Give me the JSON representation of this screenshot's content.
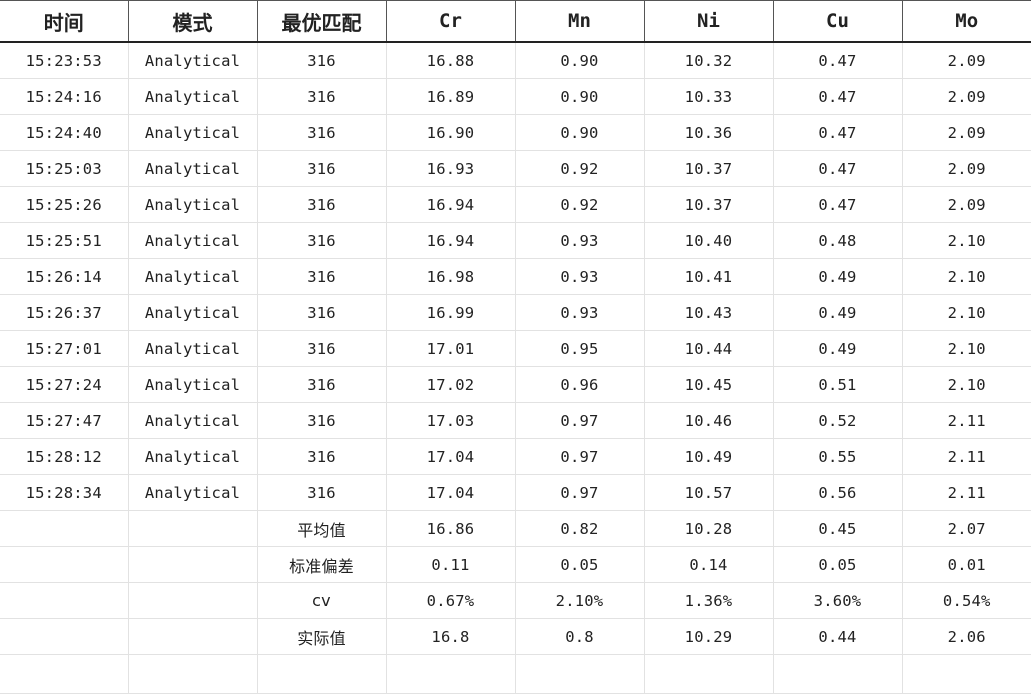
{
  "table": {
    "headers": [
      "时间",
      "模式",
      "最优匹配",
      "Cr",
      "Mn",
      "Ni",
      "Cu",
      "Mo"
    ],
    "rows": [
      [
        "15:23:53",
        "Analytical",
        "316",
        "16.88",
        "0.90",
        "10.32",
        "0.47",
        "2.09"
      ],
      [
        "15:24:16",
        "Analytical",
        "316",
        "16.89",
        "0.90",
        "10.33",
        "0.47",
        "2.09"
      ],
      [
        "15:24:40",
        "Analytical",
        "316",
        "16.90",
        "0.90",
        "10.36",
        "0.47",
        "2.09"
      ],
      [
        "15:25:03",
        "Analytical",
        "316",
        "16.93",
        "0.92",
        "10.37",
        "0.47",
        "2.09"
      ],
      [
        "15:25:26",
        "Analytical",
        "316",
        "16.94",
        "0.92",
        "10.37",
        "0.47",
        "2.09"
      ],
      [
        "15:25:51",
        "Analytical",
        "316",
        "16.94",
        "0.93",
        "10.40",
        "0.48",
        "2.10"
      ],
      [
        "15:26:14",
        "Analytical",
        "316",
        "16.98",
        "0.93",
        "10.41",
        "0.49",
        "2.10"
      ],
      [
        "15:26:37",
        "Analytical",
        "316",
        "16.99",
        "0.93",
        "10.43",
        "0.49",
        "2.10"
      ],
      [
        "15:27:01",
        "Analytical",
        "316",
        "17.01",
        "0.95",
        "10.44",
        "0.49",
        "2.10"
      ],
      [
        "15:27:24",
        "Analytical",
        "316",
        "17.02",
        "0.96",
        "10.45",
        "0.51",
        "2.10"
      ],
      [
        "15:27:47",
        "Analytical",
        "316",
        "17.03",
        "0.97",
        "10.46",
        "0.52",
        "2.11"
      ],
      [
        "15:28:12",
        "Analytical",
        "316",
        "17.04",
        "0.97",
        "10.49",
        "0.55",
        "2.11"
      ],
      [
        "15:28:34",
        "Analytical",
        "316",
        "17.04",
        "0.97",
        "10.57",
        "0.56",
        "2.11"
      ]
    ],
    "summary": [
      {
        "label": "平均值",
        "values": [
          "16.86",
          "0.82",
          "10.28",
          "0.45",
          "2.07"
        ]
      },
      {
        "label": "标准偏差",
        "values": [
          "0.11",
          "0.05",
          "0.14",
          "0.05",
          "0.01"
        ]
      },
      {
        "label": "cv",
        "values": [
          "0.67%",
          "2.10%",
          "1.36%",
          "3.60%",
          "0.54%"
        ]
      },
      {
        "label": "实际值",
        "values": [
          "16.8",
          "0.8",
          "10.29",
          "0.44",
          "2.06"
        ]
      }
    ]
  }
}
